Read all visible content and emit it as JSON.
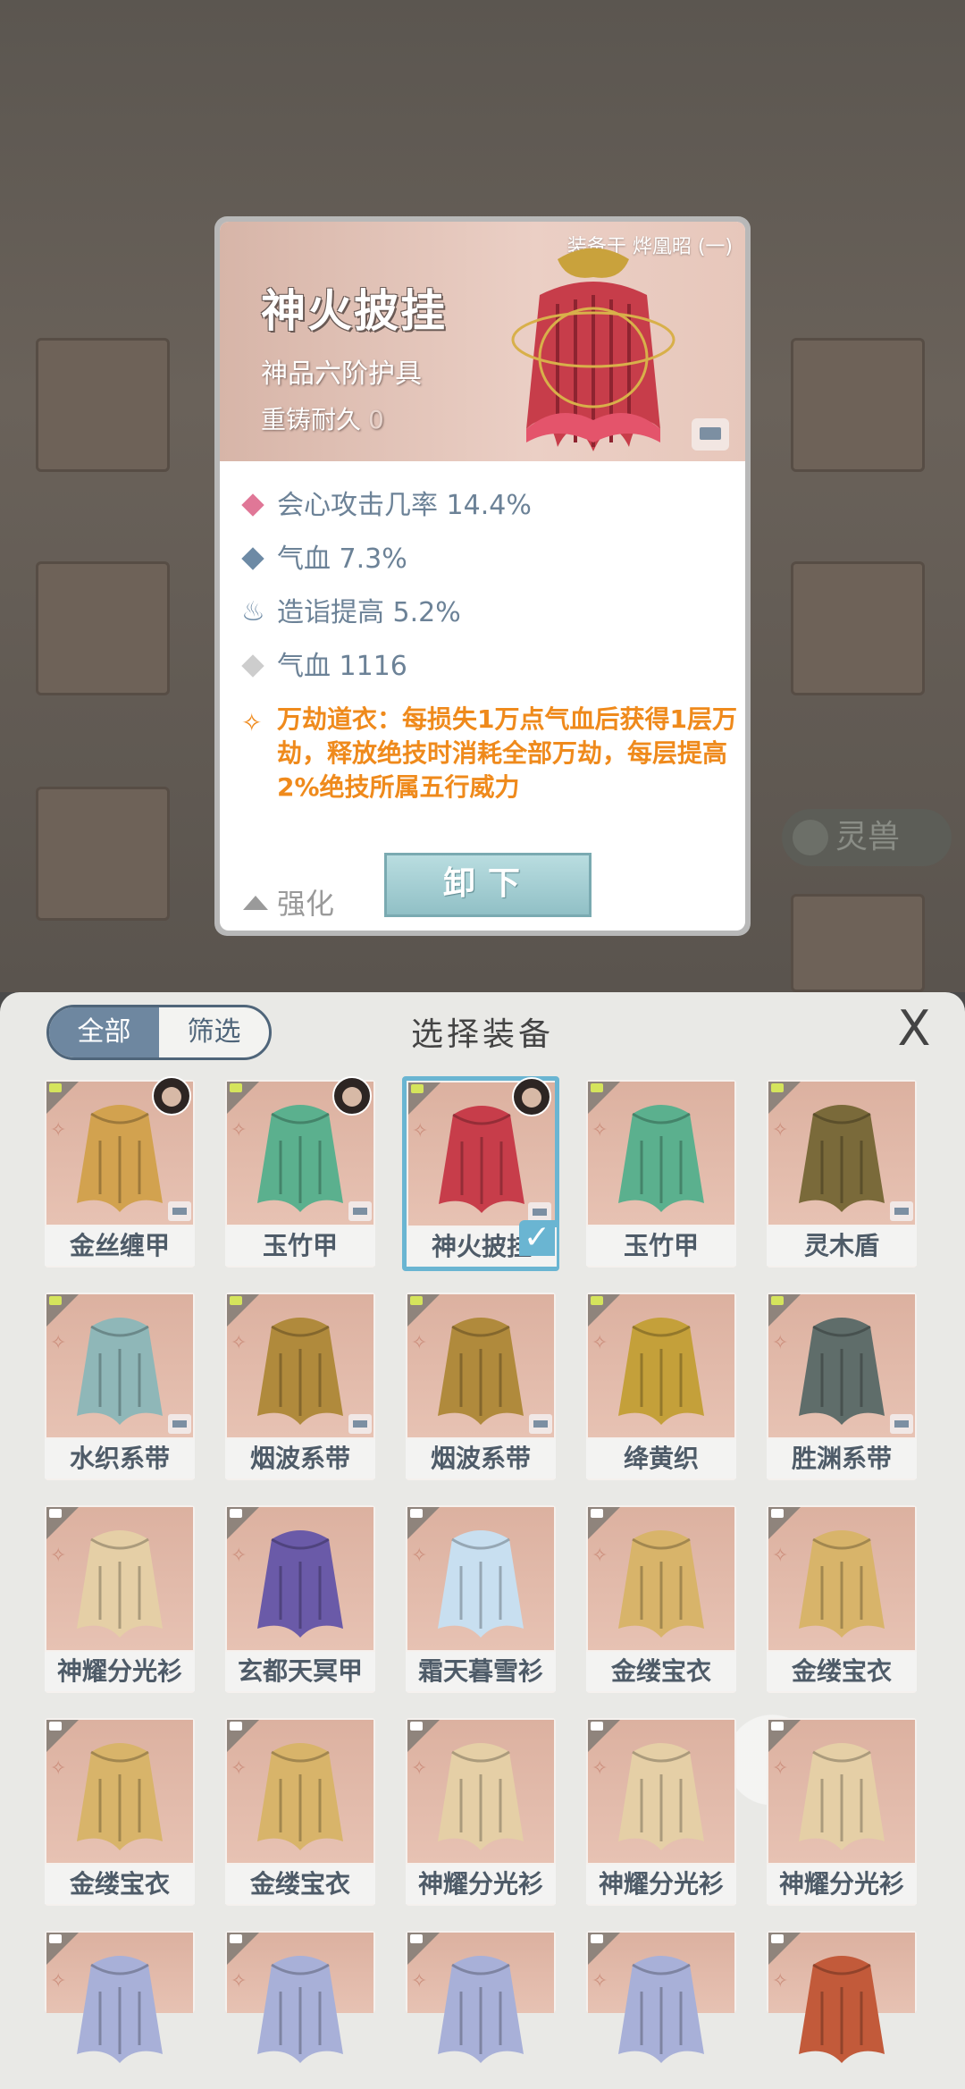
{
  "detail": {
    "equipped_on": "装备于 烨凰昭 (一)",
    "name": "神火披挂",
    "grade": "神品六阶护具",
    "reforge_label": "重铸耐久",
    "reforge_value": "0",
    "stats": [
      {
        "text": "会心攻击几率 14.4%",
        "color": "#e07797"
      },
      {
        "text": "气血 7.3%",
        "color": "#6d8aa5"
      },
      {
        "text": "造诣提高 5.2%",
        "color": "#6d8aa5"
      },
      {
        "text": "气血 1116",
        "color": "#cdcdcd"
      }
    ],
    "skill": "万劫道衣：每损失1万点气血后获得1层万劫，释放绝技时消耗全部万劫，每层提高2%绝技所属五行威力",
    "enhance_label": "强化",
    "unequip_label": "卸下"
  },
  "background": {
    "pill_label": "灵兽"
  },
  "sheet": {
    "title": "选择装备",
    "filter_all": "全部",
    "filter_screen": "筛选",
    "close_label": "X"
  },
  "items": [
    {
      "name": "金丝缠甲",
      "tag": "green",
      "owner": true,
      "lock": true,
      "color": "#d2a24f"
    },
    {
      "name": "玉竹甲",
      "tag": "green",
      "owner": true,
      "lock": true,
      "color": "#5bb08e"
    },
    {
      "name": "神火披挂",
      "tag": "green",
      "owner": true,
      "lock": true,
      "color": "#c73d4a",
      "selected": true
    },
    {
      "name": "玉竹甲",
      "tag": "green",
      "owner": false,
      "lock": false,
      "color": "#5bb08e"
    },
    {
      "name": "灵木盾",
      "tag": "green",
      "owner": false,
      "lock": true,
      "color": "#7a6a3a"
    },
    {
      "name": "水织系带",
      "tag": "green",
      "owner": false,
      "lock": true,
      "color": "#8fb7b8"
    },
    {
      "name": "烟波系带",
      "tag": "green",
      "owner": false,
      "lock": true,
      "color": "#b08a3c"
    },
    {
      "name": "烟波系带",
      "tag": "green",
      "owner": false,
      "lock": true,
      "color": "#b08a3c"
    },
    {
      "name": "绛黄织",
      "tag": "green",
      "owner": false,
      "lock": false,
      "color": "#c4a03a"
    },
    {
      "name": "胜渊系带",
      "tag": "green",
      "owner": false,
      "lock": true,
      "color": "#5f6d6a"
    },
    {
      "name": "神耀分光衫",
      "tag": "white",
      "owner": false,
      "lock": false,
      "color": "#e5cfa6"
    },
    {
      "name": "玄都天冥甲",
      "tag": "white",
      "owner": false,
      "lock": false,
      "color": "#6a5aa8"
    },
    {
      "name": "霜天暮雪衫",
      "tag": "white",
      "owner": false,
      "lock": false,
      "color": "#c8dff0"
    },
    {
      "name": "金缕宝衣",
      "tag": "white",
      "owner": false,
      "lock": false,
      "color": "#d8b46a"
    },
    {
      "name": "金缕宝衣",
      "tag": "white",
      "owner": false,
      "lock": false,
      "color": "#d8b46a"
    },
    {
      "name": "金缕宝衣",
      "tag": "white",
      "owner": false,
      "lock": false,
      "color": "#d8b46a"
    },
    {
      "name": "金缕宝衣",
      "tag": "white",
      "owner": false,
      "lock": false,
      "color": "#d8b46a"
    },
    {
      "name": "神耀分光衫",
      "tag": "white",
      "owner": false,
      "lock": false,
      "color": "#e5cfa6"
    },
    {
      "name": "神耀分光衫",
      "tag": "white",
      "owner": false,
      "lock": false,
      "color": "#e5cfa6"
    },
    {
      "name": "神耀分光衫",
      "tag": "white",
      "owner": false,
      "lock": false,
      "color": "#e5cfa6"
    },
    {
      "name": "",
      "tag": "white",
      "owner": false,
      "lock": false,
      "color": "#a8b0d8"
    },
    {
      "name": "",
      "tag": "white",
      "owner": false,
      "lock": false,
      "color": "#a8b0d8"
    },
    {
      "name": "",
      "tag": "white",
      "owner": false,
      "lock": false,
      "color": "#a8b0d8"
    },
    {
      "name": "",
      "tag": "white",
      "owner": false,
      "lock": false,
      "color": "#a8b0d8"
    },
    {
      "name": "",
      "tag": "white",
      "owner": false,
      "lock": false,
      "color": "#c25a3a"
    }
  ]
}
